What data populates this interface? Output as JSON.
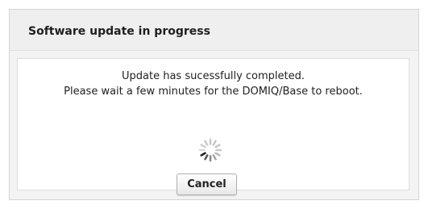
{
  "dialog": {
    "title": "Software update in progress",
    "message_line1": "Update has sucessfully completed.",
    "message_line2": "Please wait a few minutes for the DOMIQ/Base to reboot.",
    "cancel_label": "Cancel",
    "spinner_icon": "loading-spinner-icon"
  }
}
